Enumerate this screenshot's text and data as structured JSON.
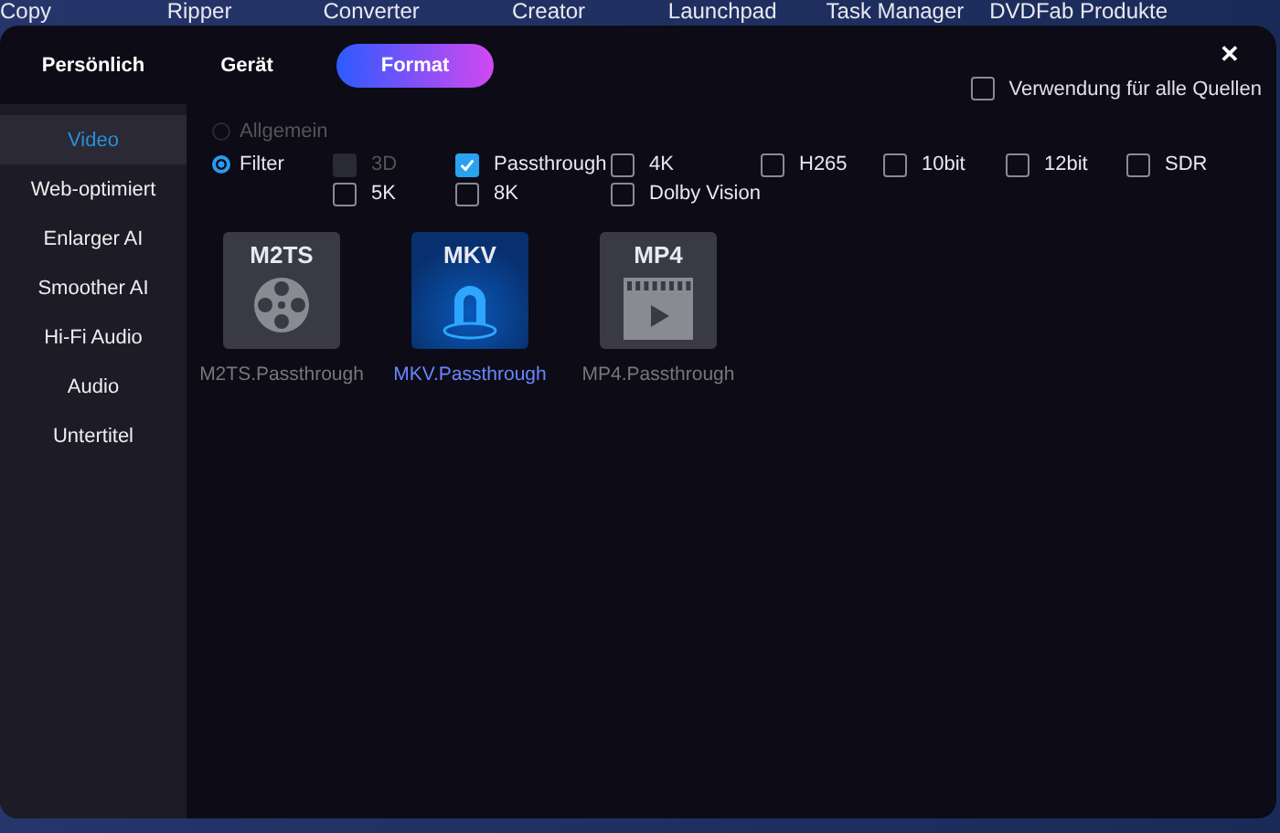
{
  "top_menu": [
    "Copy",
    "Ripper",
    "Converter",
    "Creator",
    "Launchpad",
    "Task Manager",
    "DVDFab Produkte"
  ],
  "header": {
    "title": "Persönlich",
    "close": "✕",
    "tabs": [
      {
        "label": "Gerät",
        "selected": false
      },
      {
        "label": "Format",
        "selected": true
      }
    ],
    "apply_all": {
      "label": "Verwendung für alle Quellen",
      "checked": false
    }
  },
  "sidebar": {
    "items": [
      {
        "label": "Video",
        "selected": true
      },
      {
        "label": "Web-optimiert",
        "selected": false
      },
      {
        "label": "Enlarger AI",
        "selected": false
      },
      {
        "label": "Smoother AI",
        "selected": false
      },
      {
        "label": "Hi-Fi Audio",
        "selected": false
      },
      {
        "label": "Audio",
        "selected": false
      },
      {
        "label": "Untertitel",
        "selected": false
      }
    ]
  },
  "modes": [
    {
      "label": "Allgemein",
      "selected": false,
      "disabled": true
    },
    {
      "label": "Filter",
      "selected": true,
      "disabled": false
    }
  ],
  "filters": [
    {
      "label": "3D",
      "checked": false,
      "disabled": true
    },
    {
      "label": "Passthrough",
      "checked": true,
      "disabled": false
    },
    {
      "label": "4K",
      "checked": false,
      "disabled": false
    },
    {
      "label": "H265",
      "checked": false,
      "disabled": false
    },
    {
      "label": "10bit",
      "checked": false,
      "disabled": false
    },
    {
      "label": "12bit",
      "checked": false,
      "disabled": false
    },
    {
      "label": "SDR",
      "checked": false,
      "disabled": false
    },
    {
      "label": "5K",
      "checked": false,
      "disabled": false
    },
    {
      "label": "8K",
      "checked": false,
      "disabled": false
    },
    {
      "label": "Dolby Vision",
      "checked": false,
      "disabled": false
    }
  ],
  "profiles": [
    {
      "kind": "reel",
      "badge": "M2TS",
      "label": "M2TS.Passthrough",
      "selected": false
    },
    {
      "kind": "arc",
      "badge": "MKV",
      "label": "MKV.Passthrough",
      "selected": true
    },
    {
      "kind": "film",
      "badge": "MP4",
      "label": "MP4.Passthrough",
      "selected": false
    }
  ]
}
